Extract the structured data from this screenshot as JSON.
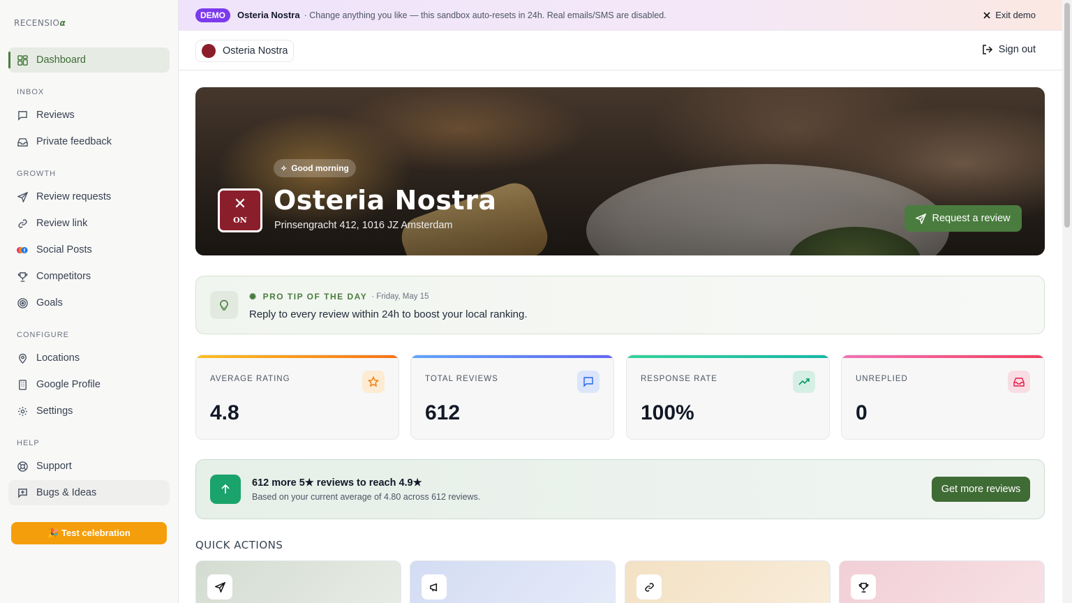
{
  "brand": {
    "logo_text": "RECENSIO",
    "logo_mark": "α"
  },
  "sidebar": {
    "dashboard": "Dashboard",
    "sections": {
      "inbox": "INBOX",
      "growth": "GROWTH",
      "configure": "CONFIGURE",
      "help": "HELP"
    },
    "items": {
      "reviews": "Reviews",
      "private_feedback": "Private feedback",
      "review_requests": "Review requests",
      "review_link": "Review link",
      "social_posts": "Social Posts",
      "competitors": "Competitors",
      "goals": "Goals",
      "locations": "Locations",
      "google_profile": "Google Profile",
      "settings": "Settings",
      "support": "Support",
      "bugs_ideas": "Bugs & Ideas"
    },
    "celebration_button": "🎉 Test celebration"
  },
  "banner": {
    "badge": "DEMO",
    "business": "Osteria Nostra",
    "message": "· Change anything you like — this sandbox auto-resets in 24h. Real emails/SMS are disabled.",
    "exit": "Exit demo"
  },
  "topbar": {
    "location": "Osteria Nostra",
    "sign_out": "Sign out"
  },
  "hero": {
    "greeting": "Good morning",
    "initials": "ON",
    "name": "Osteria Nostra",
    "address": "Prinsengracht 412, 1016 JZ Amsterdam",
    "request_button": "Request a review"
  },
  "tip": {
    "heading": "PRO TIP OF THE DAY",
    "date": "· Friday, May 15",
    "text": "Reply to every review within 24h to boost your local ranking."
  },
  "stats": [
    {
      "label": "AVERAGE RATING",
      "value": "4.8",
      "accent": "#f59e0b"
    },
    {
      "label": "TOTAL REVIEWS",
      "value": "612",
      "accent": "#6366f1"
    },
    {
      "label": "RESPONSE RATE",
      "value": "100%",
      "accent": "#10b981"
    },
    {
      "label": "UNREPLIED",
      "value": "0",
      "accent": "#ec4899"
    }
  ],
  "goal": {
    "title": "612 more 5★ reviews to reach 4.9★",
    "subtitle": "Based on your current average of 4.80 across 612 reviews.",
    "button": "Get more reviews"
  },
  "quick_actions": {
    "title": "QUICK ACTIONS"
  },
  "colors": {
    "primary": "#4a7c3f",
    "demo": "#7c3aed",
    "celebrate": "#f59e0b"
  }
}
